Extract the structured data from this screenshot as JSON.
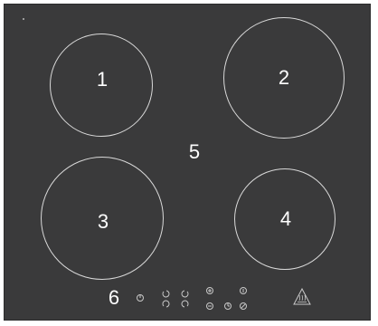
{
  "labels": {
    "zone1": "1",
    "zone2": "2",
    "zone3": "3",
    "zone4": "4",
    "center": "5",
    "controls": "6"
  },
  "colors": {
    "surface": "#3a3a3b",
    "outline": "#d9d9d9",
    "text": "#ffffff",
    "page": "#ffffff"
  },
  "icons": [
    "power-icon",
    "minus-icon",
    "plus-icon",
    "lock-icon",
    "timer-icon",
    "hot-surface-warning-icon"
  ]
}
